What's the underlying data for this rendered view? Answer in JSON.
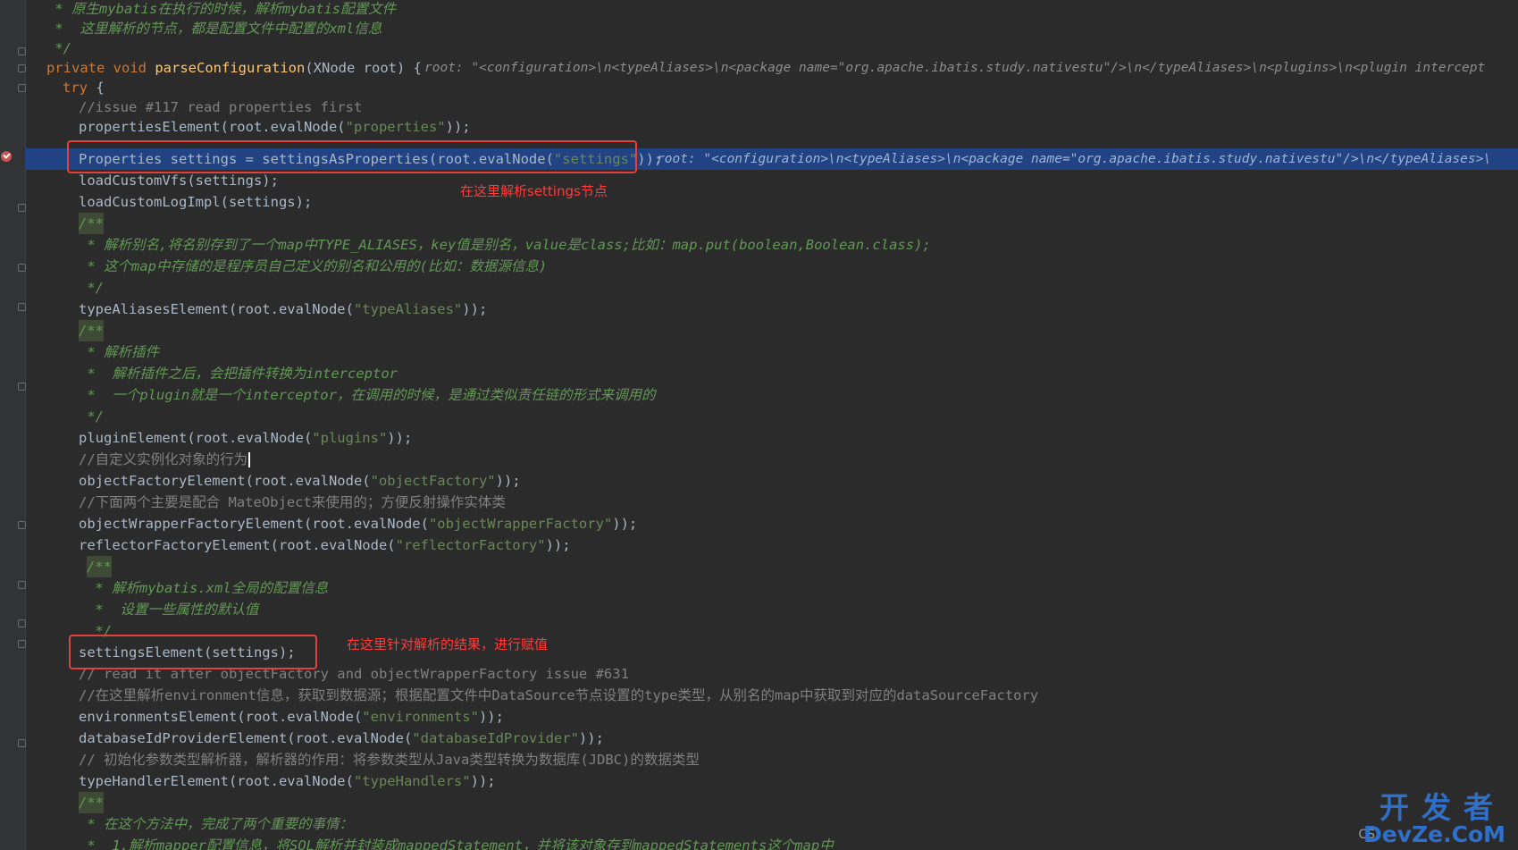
{
  "colors": {
    "background": "#2b2b2b",
    "gutter": "#313335",
    "keyword": "#cc7832",
    "method": "#ffc66d",
    "string": "#6a8759",
    "comment": "#808080",
    "doc_comment": "#629755",
    "selection": "#214283",
    "annotation_red": "#e34040",
    "watermark_blue": "#2f6fc9"
  },
  "code": {
    "l01": " * 原生mybatis在执行的时候，解析mybatis配置文件",
    "l02": " *  这里解析的节点，都是配置文件中配置的xml信息",
    "l03": " */",
    "l04": {
      "kw1": "private",
      "kw2": "void",
      "fn": "parseConfiguration",
      "rest": "(XNode root) {",
      "hint": "root: \"<configuration>\\n<typeAliases>\\n<package name=\"org.apache.ibatis.study.nativestu\"/>\\n</typeAliases>\\n<plugins>\\n<plugin intercept"
    },
    "l05": {
      "kw": "try",
      "rest": " {"
    },
    "l06": "//issue #117 read properties first",
    "l07": {
      "pre": "propertiesElement(root.evalNode(",
      "str": "\"properties\"",
      "post": "));"
    },
    "l08": {
      "pre": "Properties settings = settingsAsProperties(root.evalNode(",
      "str": "\"settings\"",
      "post": "));",
      "hint": "root: \"<configuration>\\n<typeAliases>\\n<package name=\"org.apache.ibatis.study.nativestu\"/>\\n</typeAliases>\\"
    },
    "l09": "loadCustomVfs(settings);",
    "l10": "loadCustomLogImpl(settings);",
    "l11": "/**",
    "l12": " * 解析别名,将名别存到了一个map中TYPE_ALIASES，key值是别名，value是class;比如：map.put(boolean,Boolean.class);",
    "l13": " * 这个map中存储的是程序员自己定义的别名和公用的(比如：数据源信息)",
    "l14": " */",
    "l15": {
      "pre": "typeAliasesElement(root.evalNode(",
      "str": "\"typeAliases\"",
      "post": "));"
    },
    "l16": "/**",
    "l17": " * 解析插件",
    "l18": " *  解析插件之后，会把插件转换为interceptor",
    "l19": " *  一个plugin就是一个interceptor，在调用的时候，是通过类似责任链的形式来调用的",
    "l20": " */",
    "l21": {
      "pre": "pluginElement(root.evalNode(",
      "str": "\"plugins\"",
      "post": "));"
    },
    "l22": "//自定义实例化对象的行为",
    "l23": {
      "pre": "objectFactoryElement(root.evalNode(",
      "str": "\"objectFactory\"",
      "post": "));"
    },
    "l24": "//下面两个主要是配合 MateObject来使用的；方便反射操作实体类",
    "l25": {
      "pre": "objectWrapperFactoryElement(root.evalNode(",
      "str": "\"objectWrapperFactory\"",
      "post": "));"
    },
    "l26": {
      "pre": "reflectorFactoryElement(root.evalNode(",
      "str": "\"reflectorFactory\"",
      "post": "));"
    },
    "l27": "/**",
    "l28": " * 解析mybatis.xml全局的配置信息",
    "l29": " *  设置一些属性的默认值",
    "l30": " */",
    "l31": "settingsElement(settings);",
    "l32": "// read it after objectFactory and objectWrapperFactory issue #631",
    "l33": "//在这里解析environment信息，获取到数据源；根据配置文件中DataSource节点设置的type类型，从别名的map中获取到对应的dataSourceFactory",
    "l34": {
      "pre": "environmentsElement(root.evalNode(",
      "str": "\"environments\"",
      "post": "));"
    },
    "l35": {
      "pre": "databaseIdProviderElement(root.evalNode(",
      "str": "\"databaseIdProvider\"",
      "post": "));"
    },
    "l36": "// 初始化参数类型解析器，解析器的作用：将参数类型从Java类型转换为数据库(JDBC)的数据类型",
    "l37": {
      "pre": "typeHandlerElement(root.evalNode(",
      "str": "\"typeHandlers\"",
      "post": "));"
    },
    "l38": "/**",
    "l39": " * 在这个方法中，完成了两个重要的事情：",
    "l40": " *  1.解析mapper配置信息，将SQL解析并封装成mappedStatement，并将该对象存到mappedStatements这个map中"
  },
  "annotations": {
    "settings_parse": "在这里解析settings节点",
    "settings_assign": "在这里针对解析的结果，进行赋值"
  },
  "watermark": {
    "cn": "开发者",
    "en": "DevZe.CoM",
    "cs": "CS"
  }
}
